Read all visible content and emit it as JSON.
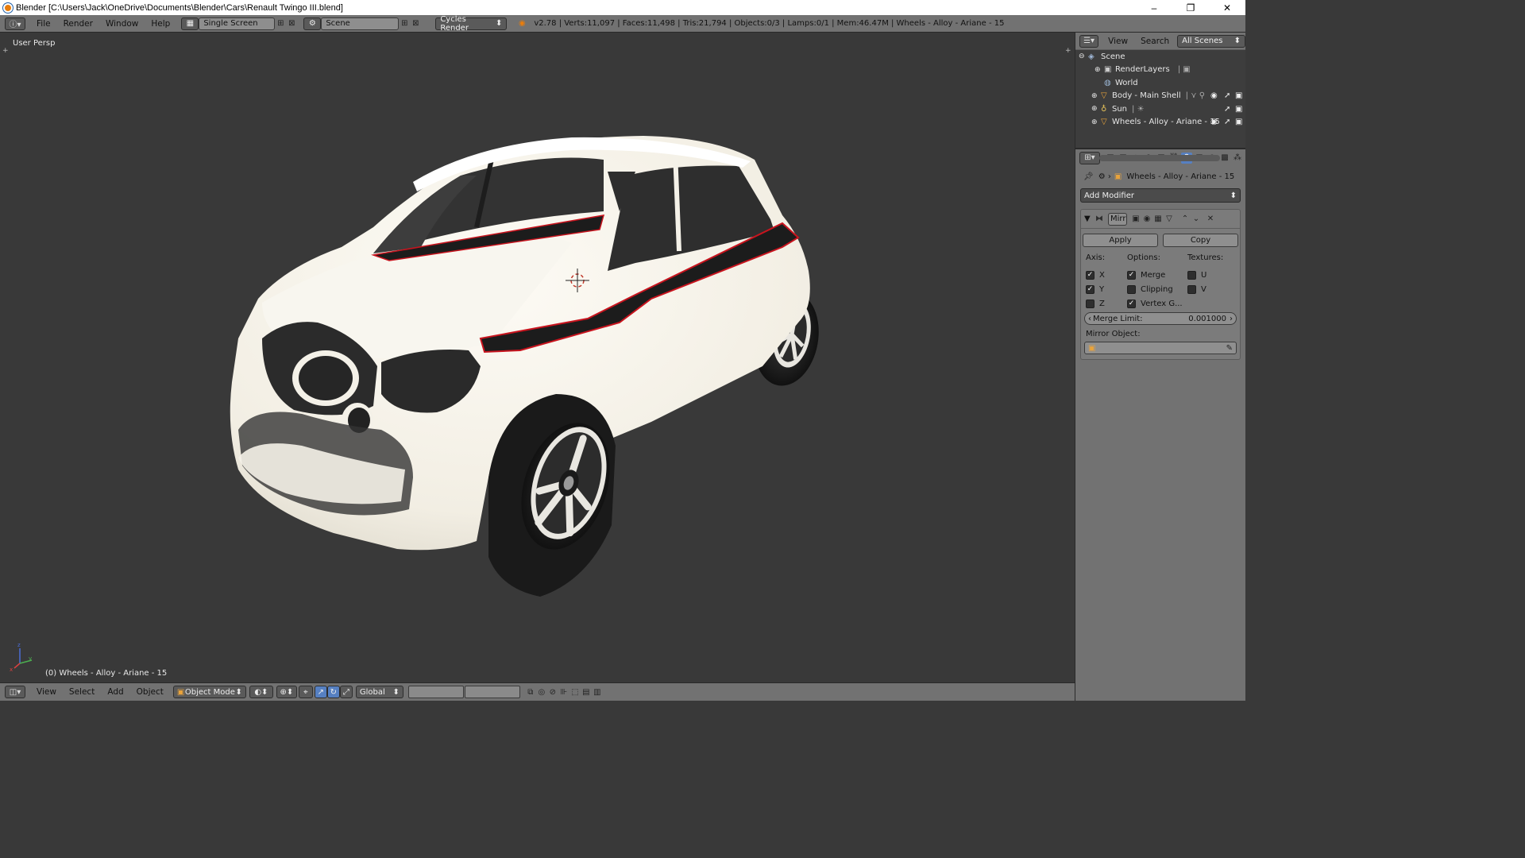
{
  "window": {
    "title": "Blender [C:\\Users\\Jack\\OneDrive\\Documents\\Blender\\Cars\\Renault Twingo III.blend]",
    "minimize": "–",
    "maximize": "❐",
    "close": "✕"
  },
  "info_header": {
    "menus": [
      "File",
      "Render",
      "Window",
      "Help"
    ],
    "screen_layout": "Single Screen",
    "scene": "Scene",
    "render_engine": "Cycles Render",
    "stats": "v2.78 | Verts:11,097 | Faces:11,498 | Tris:21,794 | Objects:0/3 | Lamps:0/1 | Mem:46.47M | Wheels - Alloy - Ariane - 15"
  },
  "viewport": {
    "view_name": "User Persp",
    "active_object_info": "(0) Wheels - Alloy - Ariane - 15"
  },
  "view3d_header": {
    "menus": [
      "View",
      "Select",
      "Add",
      "Object"
    ],
    "mode": "Object Mode",
    "orientation": "Global"
  },
  "outliner": {
    "header": {
      "view": "View",
      "search": "Search",
      "display_mode": "All Scenes"
    },
    "items": [
      {
        "label": "Scene",
        "icon": "scene-icon"
      },
      {
        "label": "RenderLayers",
        "icon": "renderlayers-icon"
      },
      {
        "label": "World",
        "icon": "world-icon"
      },
      {
        "label": "Body - Main Shell",
        "icon": "mesh-icon"
      },
      {
        "label": "Sun",
        "icon": "lamp-icon"
      },
      {
        "label": "Wheels - Alloy - Ariane - 15",
        "icon": "mesh-icon"
      }
    ]
  },
  "properties": {
    "context_path": "Wheels - Alloy - Ariane - 15",
    "add_modifier": "Add Modifier",
    "modifier": {
      "name": "Mirr",
      "apply": "Apply",
      "copy": "Copy",
      "axis_label": "Axis:",
      "options_label": "Options:",
      "textures_label": "Textures:",
      "axis": [
        {
          "label": "X",
          "checked": true
        },
        {
          "label": "Y",
          "checked": true
        },
        {
          "label": "Z",
          "checked": false
        }
      ],
      "options": [
        {
          "label": "Merge",
          "checked": true
        },
        {
          "label": "Clipping",
          "checked": false
        },
        {
          "label": "Vertex G...",
          "checked": true
        }
      ],
      "textures": [
        {
          "label": "U",
          "checked": false
        },
        {
          "label": "V",
          "checked": false
        }
      ],
      "merge_limit_label": "Merge Limit:",
      "merge_limit_value": "0.001000",
      "mirror_object_label": "Mirror Object:"
    }
  },
  "colors": {
    "viewport_bg": "#393939",
    "header_bg": "#727272",
    "car_body": "#f6f3ea",
    "accent_red": "#c8141e",
    "active_blue": "#5680c2"
  }
}
